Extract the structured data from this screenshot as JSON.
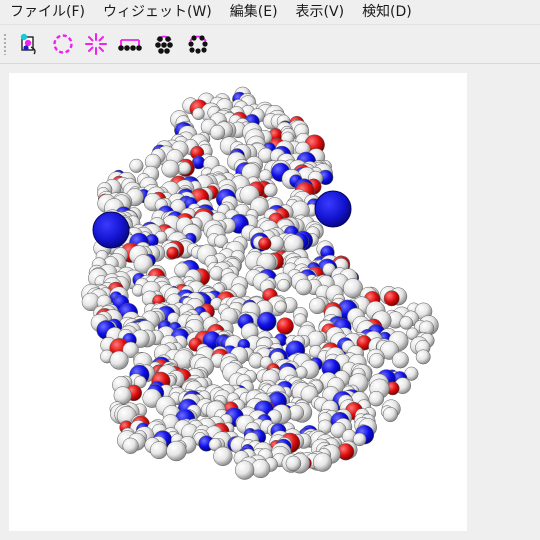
{
  "menubar": {
    "items": [
      "ファイル(F)",
      "ウィジェット(W)",
      "編集(E)",
      "表示(V)",
      "検知(D)"
    ]
  },
  "toolbar": {
    "tools": [
      {
        "icon": "molecule-file-icon"
      },
      {
        "icon": "dashed-circle-icon"
      },
      {
        "icon": "burst-icon"
      },
      {
        "icon": "atom-chain-icon"
      },
      {
        "icon": "atom-cluster-icon"
      },
      {
        "icon": "atom-ring-icon"
      }
    ]
  },
  "viewer": {
    "style": "space-filling",
    "colors": {
      "carbon": "#f2f2f2",
      "nitrogen": "#1010e6",
      "oxygen": "#e01010",
      "ion": "#1414d2",
      "accent": "#ee22ee"
    }
  }
}
